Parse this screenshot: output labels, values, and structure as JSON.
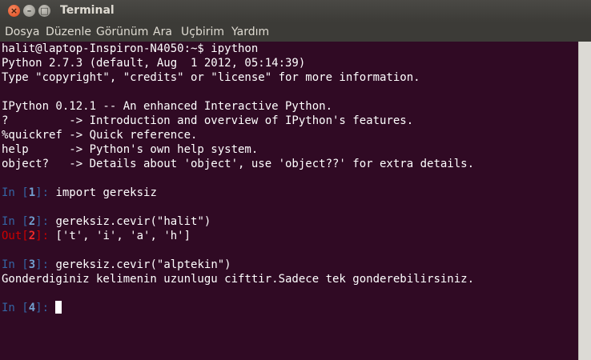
{
  "window": {
    "title": "Terminal"
  },
  "titlebar_buttons": {
    "close": "×",
    "minimize": "–",
    "maximize": "□"
  },
  "menu": [
    "Dosya",
    "Düzenle",
    "Görünüm",
    "Ara",
    "Uçbirim",
    "Yardım"
  ],
  "terminal": {
    "lines": [
      "halit@laptop-Inspiron-N4050:~$ ipython",
      "Python 2.7.3 (default, Aug  1 2012, 05:14:39)",
      "Type \"copyright\", \"credits\" or \"license\" for more information.",
      "IPython 0.12.1 -- An enhanced Interactive Python.",
      "?         -> Introduction and overview of IPython's features.",
      "%quickref -> Quick reference.",
      "help      -> Python's own help system.",
      "object?   -> Details about 'object', use 'object??' for extra details."
    ],
    "in_label": "In",
    "out_label": "Out",
    "inputs": [
      {
        "num": "1",
        "code": "import gereksiz"
      },
      {
        "num": "2",
        "code": "gereksiz.cevir(\"halit\")"
      },
      {
        "num": "3",
        "code": "gereksiz.cevir(\"alptekin\")"
      },
      {
        "num": "4",
        "code": ""
      }
    ],
    "outputs": [
      {
        "num": "2",
        "text": "['t', 'i', 'a', 'h']"
      }
    ],
    "stdout": "Gonderdiginiz kelimenin uzunlugu cifttir.Sadece tek gonderebilirsiniz."
  },
  "colors": {
    "background": "#300a24",
    "text": "#ffffff",
    "prompt": "#3465a4",
    "out_prompt": "#cc0000"
  }
}
